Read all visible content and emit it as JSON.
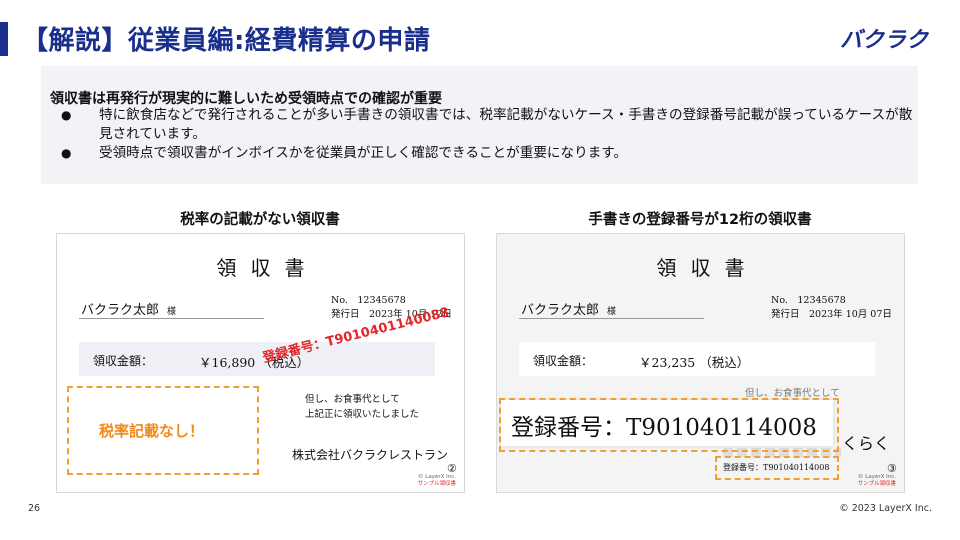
{
  "header": {
    "title": "【解説】従業員編:経費精算の申請",
    "logo_text": "バクラク"
  },
  "summary": {
    "heading": "領収書は再発行が現実的に難しいため受領時点での確認が重要",
    "bullets": [
      "特に飲食店などで発行されることが多い手書きの領収書では、税率記載がないケース・手書きの登録番号記載が誤っているケースが散見されています。",
      "受領時点で領収書がインボイスかを従業員が正しく確認できることが重要になります。"
    ],
    "bullet_glyph": "●"
  },
  "examples": {
    "left": {
      "caption": "税率の記載がない領収書",
      "receipt": {
        "title": "領収書",
        "recipient": "バクラク太郎",
        "honorific": "様",
        "number": "No.　12345678",
        "issue_date": "発行日　2023年 10月 12日",
        "amount_label": "領収金額：",
        "amount": "￥16,890 （税込）",
        "note_line1": "但し、お食事代として",
        "note_line2": "上記正に領収いたしました",
        "company": "株式会社バクラクレストラン",
        "circled_number": "②",
        "copyright": "© LayerX Inc.",
        "sample_note": "サンプル領収書"
      },
      "callout": "税率記載なし！",
      "stamp": "登録番号：T9010401140088"
    },
    "right": {
      "caption": "手書きの登録番号が12桁の領収書",
      "receipt": {
        "title": "領収書",
        "recipient": "バクラク太郎",
        "honorific": "様",
        "number": "No.　12345678",
        "issue_date": "発行日　2023年 10月 07日",
        "amount_label": "領収金額：",
        "amount": "￥23,235 （税込）",
        "note_partial": "但し、お食事代として",
        "circled_number": "③",
        "copyright": "© LayerX Inc.",
        "sample_note": "サンプル領収書",
        "partial_brand": "くらく"
      },
      "big_registration": "登録番号：T901040114008",
      "small_registration": "登録番号：T901040114008"
    }
  },
  "footer": {
    "page_number": "26",
    "copyright": "© 2023 LayerX Inc."
  },
  "colors": {
    "brand": "#1a2e8c",
    "callout": "#f08a1a",
    "stamp": "#e2262a",
    "summary_bg": "#f1f3f7"
  }
}
